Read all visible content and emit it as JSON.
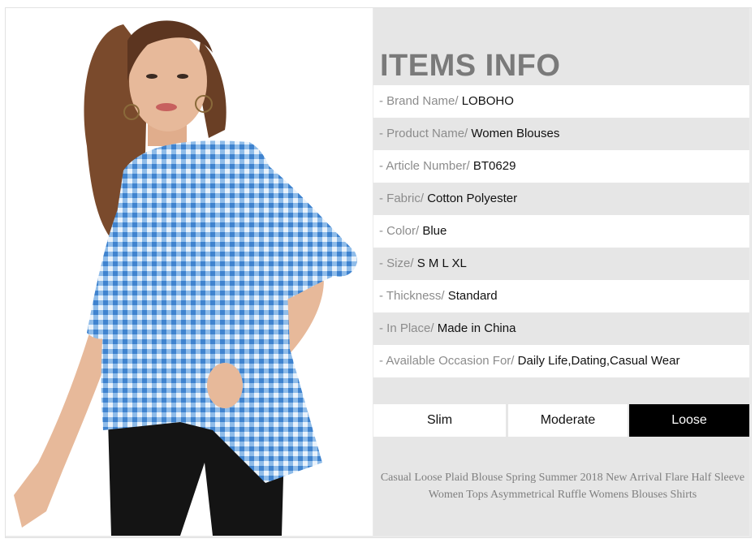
{
  "section_title": "ITEMS INFO",
  "specs": [
    {
      "label": "- Brand Name/ ",
      "value": "LOBOHO"
    },
    {
      "label": "- Product Name/ ",
      "value": "Women Blouses"
    },
    {
      "label": "- Article Number/ ",
      "value": "BT0629"
    },
    {
      "label": "- Fabric/ ",
      "value": "Cotton Polyester"
    },
    {
      "label": "- Color/ ",
      "value": "Blue"
    },
    {
      "label": "- Size/ ",
      "value": "S M L XL"
    },
    {
      "label": "- Thickness/ ",
      "value": "Standard"
    },
    {
      "label": "- In Place/ ",
      "value": "Made in China"
    },
    {
      "label": "- Available Occasion For/ ",
      "value": "Daily Life,Dating,Casual Wear"
    }
  ],
  "fit_options": [
    "Slim",
    "Moderate",
    "Loose"
  ],
  "selected_fit": "Loose",
  "description": "Casual Loose Plaid Blouse Spring Summer 2018 New Arrival Flare Half Sleeve Women Tops Asymmetrical Ruffle Womens Blouses Shirts",
  "colors": {
    "blouse": "#5a9ad8",
    "pants": "#141414",
    "hair": "#7a4a2c",
    "skin": "#e7b99a",
    "fit_active": "#000000"
  }
}
